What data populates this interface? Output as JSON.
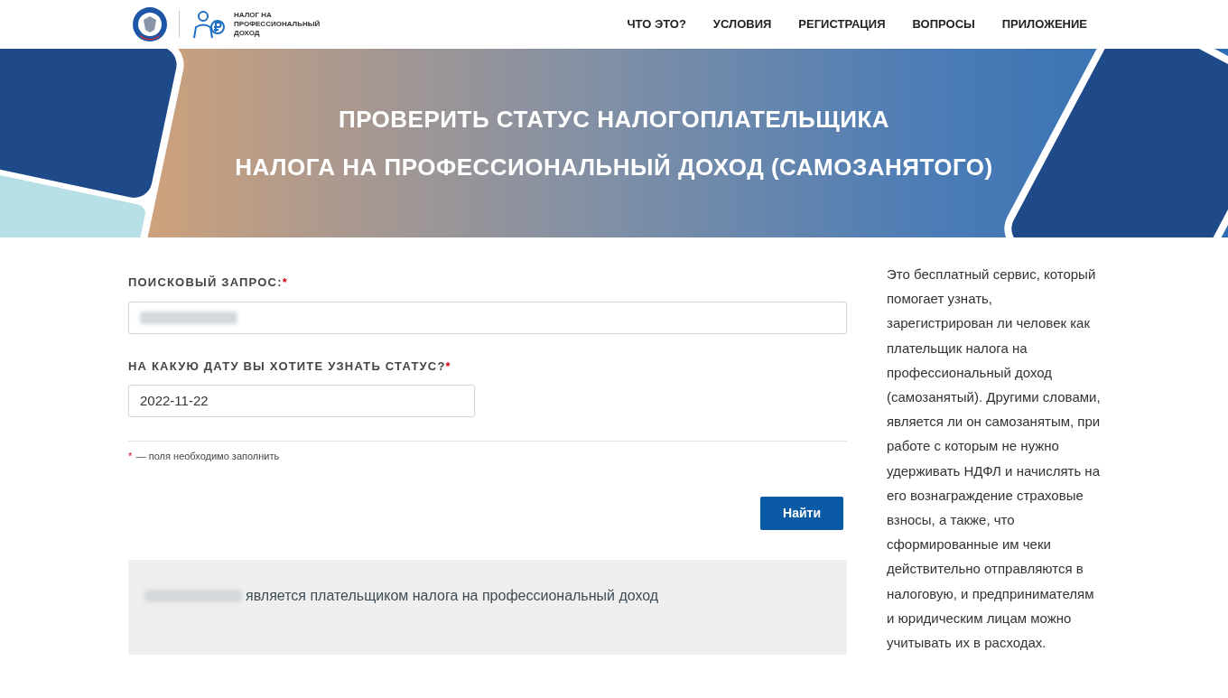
{
  "header": {
    "logo_text": "НАЛОГ НА ПРОФЕССИОНАЛЬНЫЙ ДОХОД",
    "nav": [
      {
        "label": "ЧТО ЭТО?"
      },
      {
        "label": "УСЛОВИЯ"
      },
      {
        "label": "РЕГИСТРАЦИЯ"
      },
      {
        "label": "ВОПРОСЫ"
      },
      {
        "label": "ПРИЛОЖЕНИЕ"
      }
    ]
  },
  "banner": {
    "title_lines": [
      "ПРОВЕРИТЬ СТАТУС НАЛОГОПЛАТЕЛЬЩИКА",
      "НАЛОГА НА ПРОФЕССИОНАЛЬНЫЙ ДОХОД (САМОЗАНЯТОГО)"
    ]
  },
  "form": {
    "fields": [
      {
        "label": "ПОИСКОВЫЙ ЗАПРОС:",
        "required": true,
        "redacted": true
      },
      {
        "label": "НА КАКУЮ ДАТУ ВЫ ХОТИТЕ УЗНАТЬ СТАТУС?",
        "required": true,
        "redacted": false,
        "value": "2022-11-22"
      }
    ],
    "required_mark": "*",
    "required_note": "— поля необходимо заполнить",
    "submit": "Найти"
  },
  "result": {
    "redacted": true,
    "text": "является плательщиком налога на профессиональный доход"
  },
  "sidebar": {
    "text": "Это бесплатный сервис, который помогает узнать, зарегистрирован ли человек как плательщик налога на профессиональный доход (самозанятый). Другими словами, является ли он самозанятым, при работе с которым не нужно удерживать НДФЛ и начислять на его вознаграждение страховые взносы, а также, что сформированные им чеки действительно отправляются в налоговую, и предпринимателям и юридическим лицам можно учитывать их в расходах."
  }
}
